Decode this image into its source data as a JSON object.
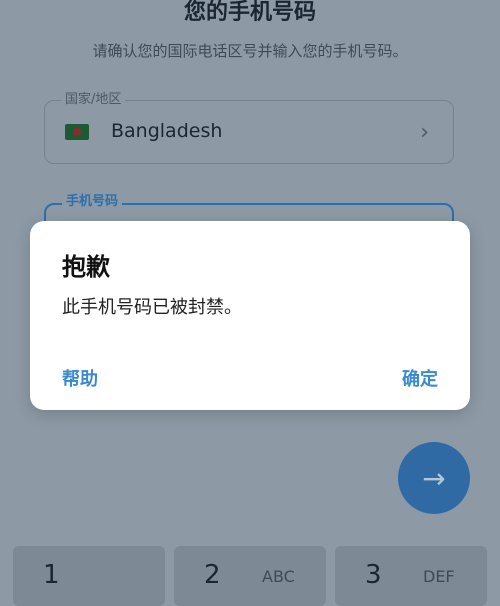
{
  "header": {
    "title": "您的手机号码",
    "subtitle": "请确认您的国际电话区号并输入您的手机号码。"
  },
  "country_field": {
    "label": "国家/地区",
    "value": "Bangladesh",
    "flag": "bangladesh-flag"
  },
  "phone_field": {
    "label": "手机号码"
  },
  "dialog": {
    "title": "抱歉",
    "message": "此手机号码已被封禁。",
    "help_label": "帮助",
    "ok_label": "确定"
  },
  "next_button": {
    "icon": "arrow-right-icon"
  },
  "keypad": [
    {
      "digit": "1",
      "letters": ""
    },
    {
      "digit": "2",
      "letters": "ABC"
    },
    {
      "digit": "3",
      "letters": "DEF"
    }
  ],
  "colors": {
    "accent": "#2f6aa5",
    "dialog_button": "#3b8ad0"
  }
}
